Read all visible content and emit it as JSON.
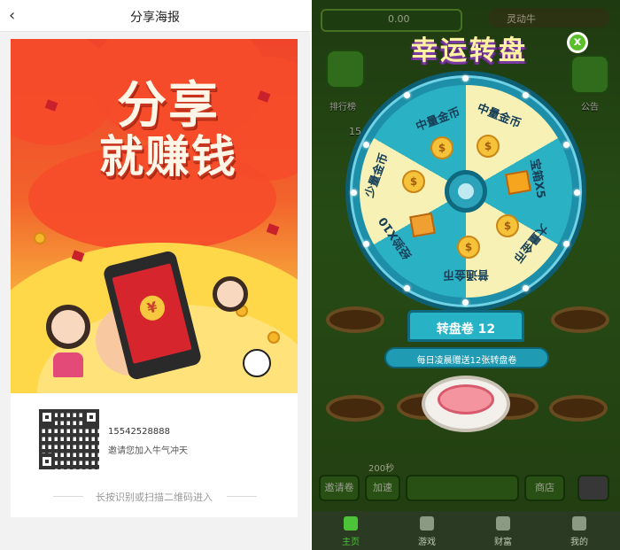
{
  "left": {
    "header": {
      "back_icon": "‹",
      "title": "分享海报"
    },
    "poster": {
      "headline_line1": "分享",
      "headline_line2": "就赚钱",
      "phone_icon": "¥"
    },
    "qr_card": {
      "phone_number": "15542528888",
      "invite_text": "邀请您加入牛气冲天",
      "hint": "长按识别或扫描二维码进入"
    }
  },
  "right": {
    "top": {
      "balance": "0.00",
      "name": "灵动牛"
    },
    "side_buttons": {
      "ranking_label": "排行榜",
      "notice_label": "公告"
    },
    "coin_count": "15",
    "wheel": {
      "title": "幸运转盘",
      "close_icon": "x",
      "segments": [
        "中量金币",
        "中量金币",
        "宝箱X5",
        "大量金币",
        "普通金币",
        "经验X10",
        "少量金币"
      ],
      "coin_glyph": "$",
      "ticket_label": "转盘卷 12",
      "daily_note": "每日凌晨赠送12张转盘卷"
    },
    "timer_left": "200秒",
    "toolbar": {
      "invite": "邀请卷",
      "speed": "加速",
      "shop": "商店"
    },
    "tabs": [
      {
        "label": "主页",
        "icon": "home-icon"
      },
      {
        "label": "游戏",
        "icon": "gamepad-icon"
      },
      {
        "label": "财富",
        "icon": "money-bag-icon"
      },
      {
        "label": "我的",
        "icon": "profile-icon"
      }
    ],
    "colors": {
      "accent_green": "#4cc338",
      "wheel_teal": "#2bb1c4",
      "wheel_cream": "#f7f1b5"
    }
  }
}
